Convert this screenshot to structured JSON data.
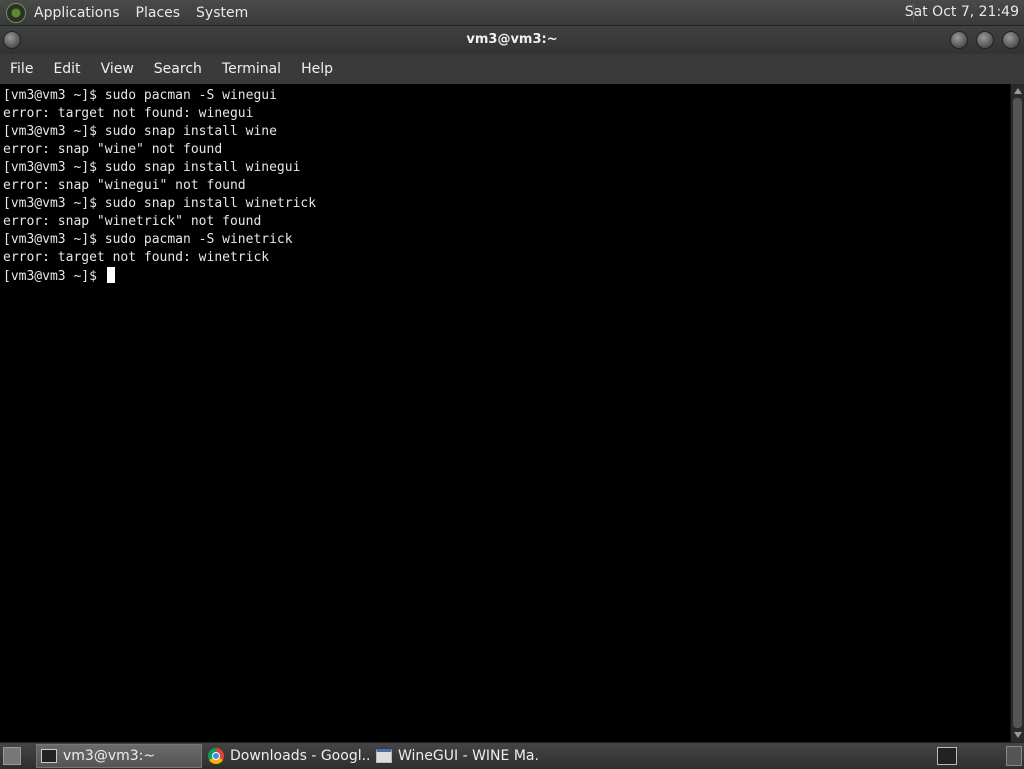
{
  "topbar": {
    "menus": [
      "Applications",
      "Places",
      "System"
    ],
    "clock": "Sat Oct  7, 21:49"
  },
  "window": {
    "title": "vm3@vm3:~"
  },
  "menubar": {
    "items": [
      "File",
      "Edit",
      "View",
      "Search",
      "Terminal",
      "Help"
    ]
  },
  "terminal": {
    "lines": [
      "[vm3@vm3 ~]$ sudo pacman -S winegui",
      "error: target not found: winegui",
      "[vm3@vm3 ~]$ sudo snap install wine",
      "error: snap \"wine\" not found",
      "[vm3@vm3 ~]$ sudo snap install winegui",
      "error: snap \"winegui\" not found",
      "[vm3@vm3 ~]$ sudo snap install winetrick",
      "error: snap \"winetrick\" not found",
      "[vm3@vm3 ~]$ sudo pacman -S winetrick",
      "error: target not found: winetrick"
    ],
    "prompt": "[vm3@vm3 ~]$ "
  },
  "taskbar": {
    "tasks": [
      {
        "label": "vm3@vm3:~",
        "icon": "terminal-icon",
        "active": true
      },
      {
        "label": "Downloads - Googl...",
        "icon": "chrome-icon",
        "active": false
      },
      {
        "label": "WineGUI - WINE Ma...",
        "icon": "window-icon",
        "active": false
      }
    ]
  }
}
